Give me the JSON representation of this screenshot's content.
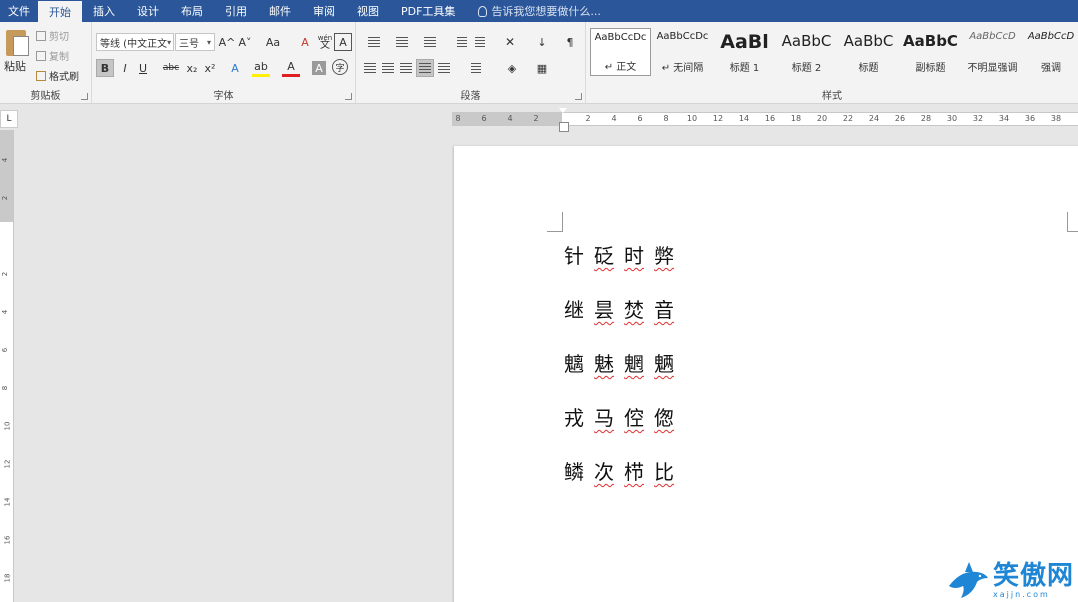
{
  "tabs": [
    "文件",
    "开始",
    "插入",
    "设计",
    "布局",
    "引用",
    "邮件",
    "审阅",
    "视图",
    "PDF工具集"
  ],
  "active_tab": "开始",
  "tell_me": "告诉我您想要做什么...",
  "clipboard": {
    "paste": "粘贴",
    "cut": "剪切",
    "copy": "复制",
    "format_painter": "格式刷",
    "label": "剪贴板"
  },
  "font": {
    "name": "等线 (中文正文",
    "size": "三号",
    "label": "字体",
    "bold": "B",
    "italic": "I",
    "underline": "U",
    "strike": "abc",
    "sub": "x₂",
    "sup": "x²",
    "grow": "A^",
    "shrink": "A˅",
    "case": "Aa",
    "clear": "A",
    "pinyin": "文",
    "pinyin_top": "wén",
    "border": "A",
    "effects": "A",
    "highlight": "ab",
    "color": "A",
    "shade": "A",
    "enclose": "字"
  },
  "paragraph": {
    "label": "段落"
  },
  "styles": {
    "label": "样式",
    "items": [
      {
        "preview": "AaBbCcDc",
        "name": "↵ 正文"
      },
      {
        "preview": "AaBbCcDc",
        "name": "↵ 无间隔"
      },
      {
        "preview": "AaBl",
        "name": "标题 1"
      },
      {
        "preview": "AaBbC",
        "name": "标题 2"
      },
      {
        "preview": "AaBbC",
        "name": "标题"
      },
      {
        "preview": "AaBbC",
        "name": "副标题"
      },
      {
        "preview": "AaBbCcD",
        "name": "不明显强调"
      },
      {
        "preview": "AaBbCcD",
        "name": "强调"
      }
    ]
  },
  "ruler": {
    "corner": "L",
    "ticks": [
      "8",
      "6",
      "4",
      "2",
      "",
      "2",
      "4",
      "6",
      "8",
      "10",
      "12",
      "14",
      "16",
      "18",
      "20",
      "22",
      "24",
      "26",
      "28",
      "30",
      "32",
      "34",
      "36",
      "38"
    ],
    "vticks": [
      "4",
      "2",
      "",
      "2",
      "4",
      "6",
      "8",
      "10",
      "12",
      "14",
      "16",
      "18"
    ]
  },
  "document": {
    "lines": [
      [
        "针",
        "砭",
        "时",
        "弊"
      ],
      [
        "继",
        "昙",
        "焚",
        "音"
      ],
      [
        "魑",
        "魅",
        "魍",
        "魉"
      ],
      [
        "戎",
        "马",
        "倥",
        "偬"
      ],
      [
        "鳞",
        "次",
        "栉",
        "比"
      ]
    ],
    "squiggled_lines": [
      0,
      1,
      2,
      3,
      4
    ]
  },
  "watermark": {
    "cn": "笑傲网",
    "url": "xajjn.com"
  }
}
